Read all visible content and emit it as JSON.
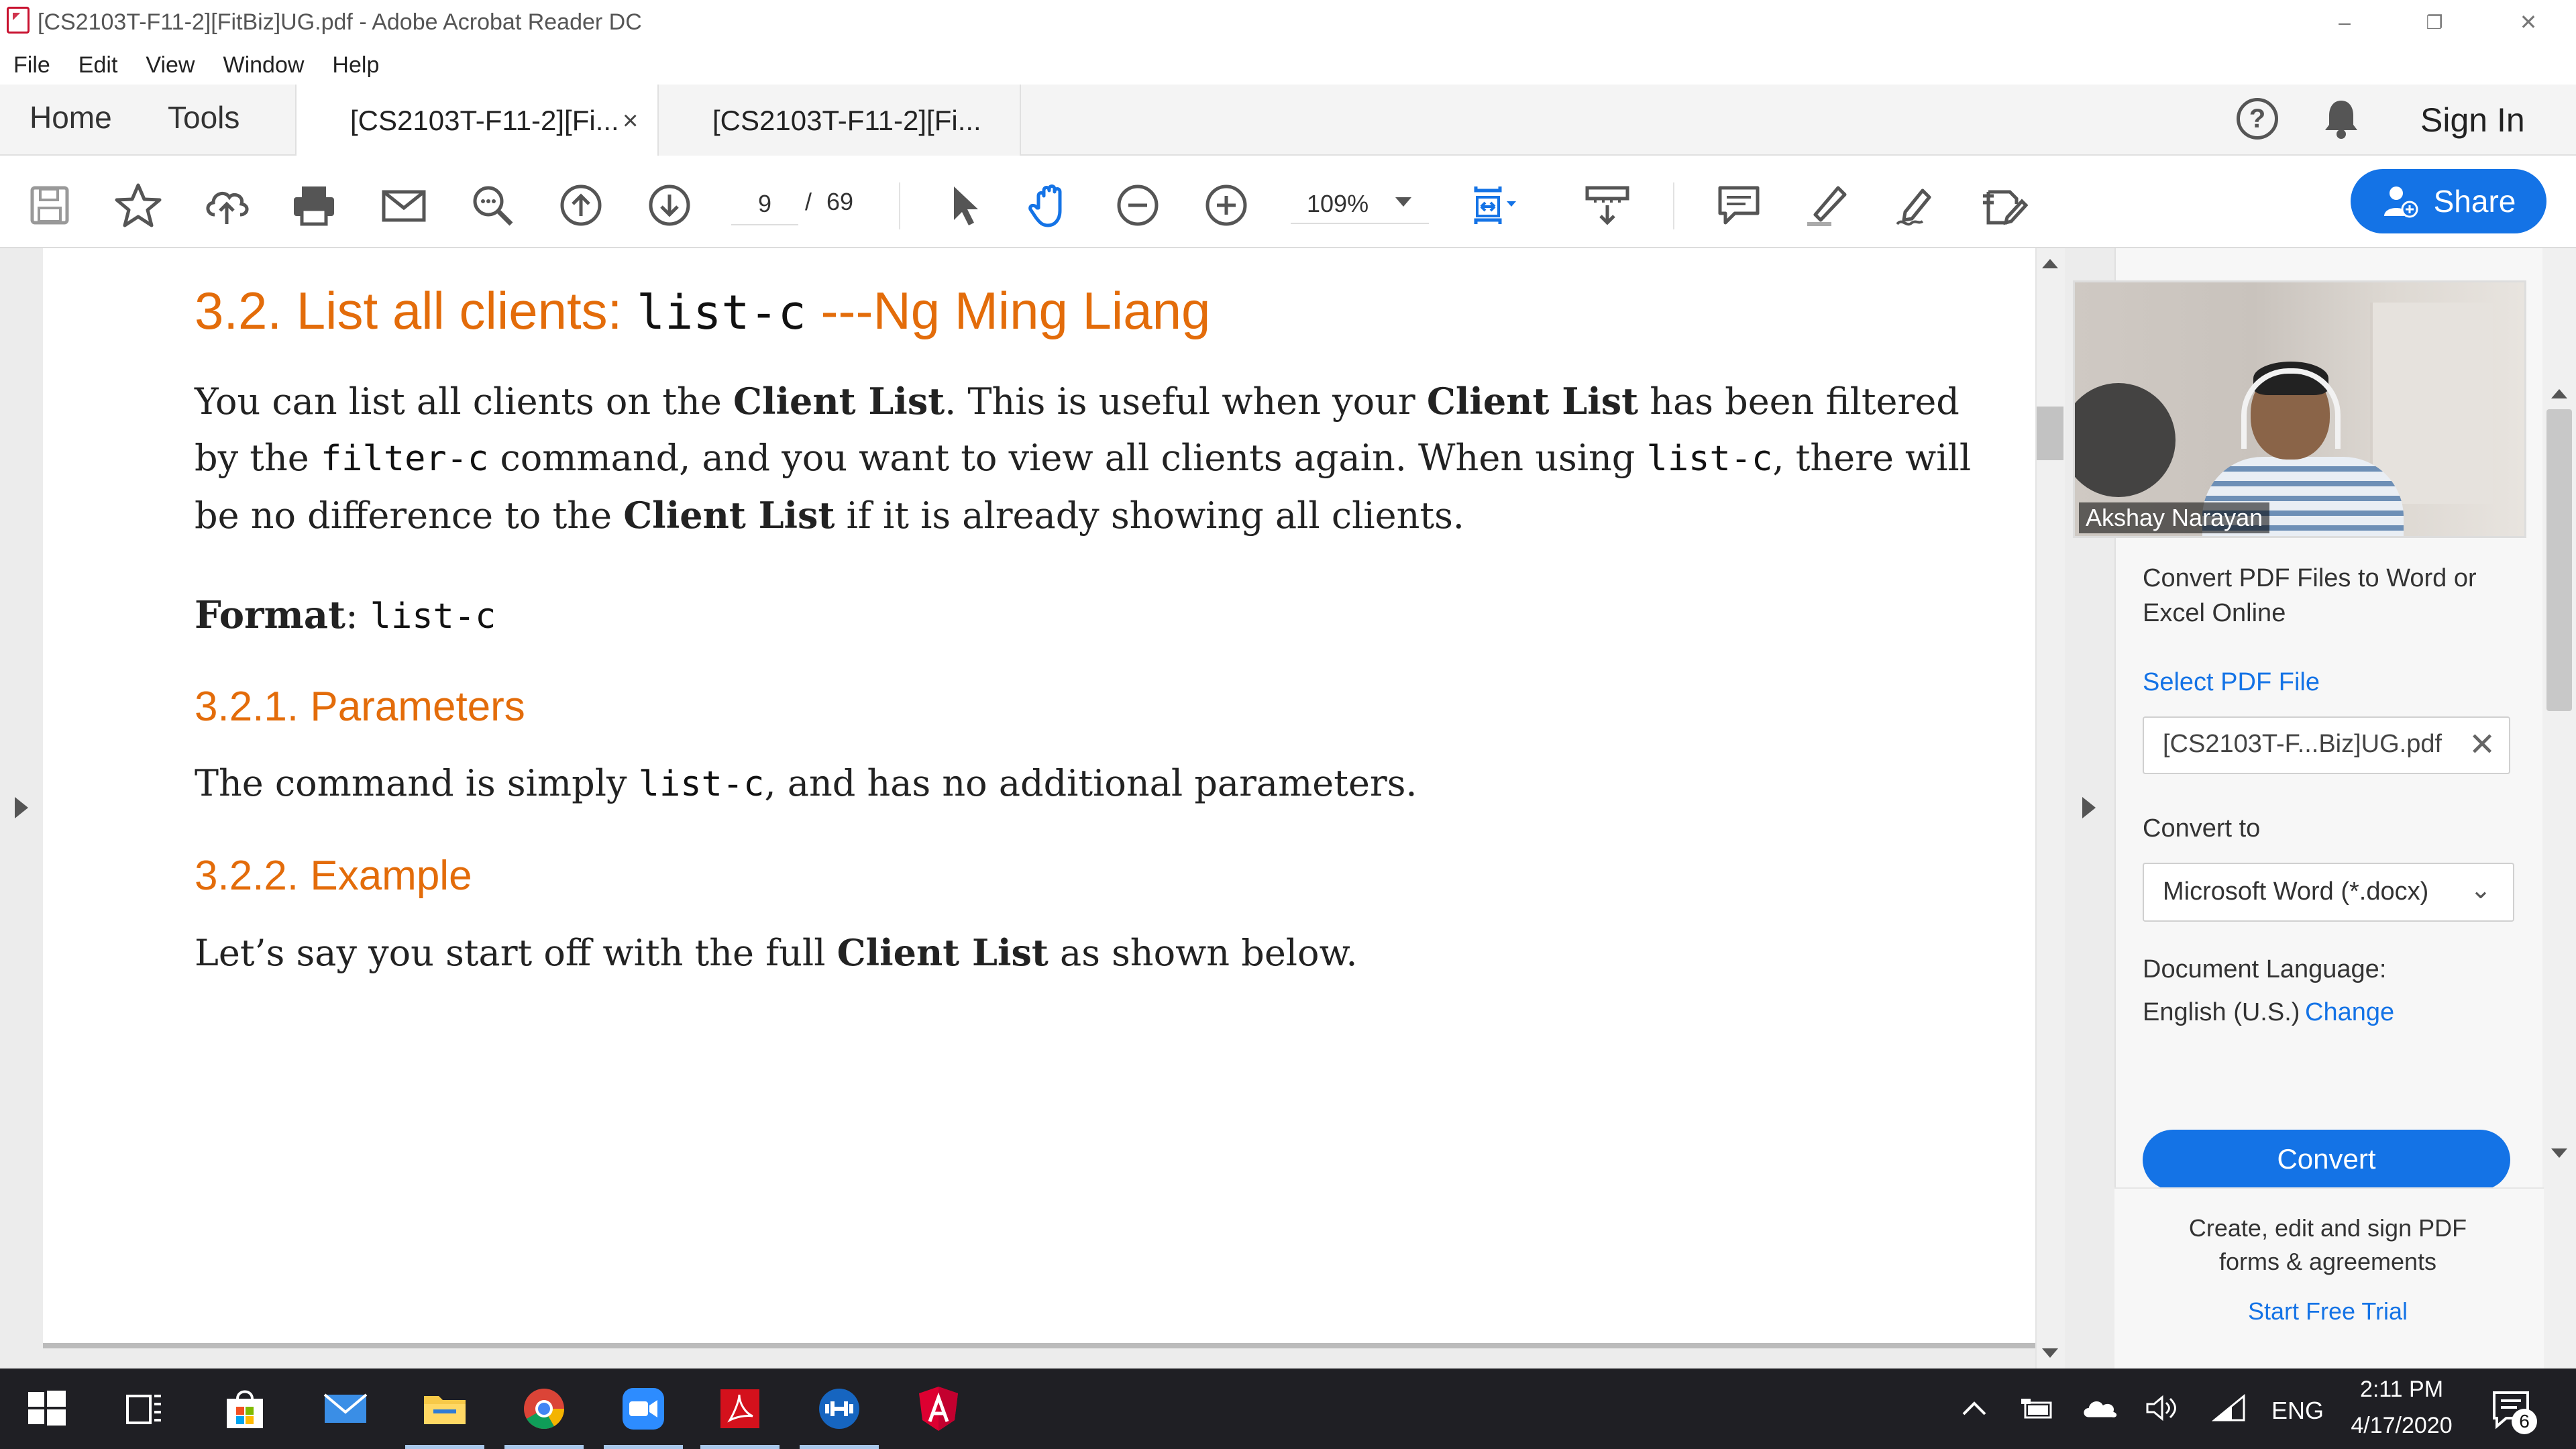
{
  "window": {
    "title": "[CS2103T-F11-2][FitBiz]UG.pdf - Adobe Acrobat Reader DC",
    "minimize": "–",
    "restore": "❐",
    "close": "✕"
  },
  "menu": [
    "File",
    "Edit",
    "View",
    "Window",
    "Help"
  ],
  "tabs": {
    "home": "Home",
    "tools": "Tools",
    "doc1": "[CS2103T-F11-2][Fi...",
    "doc1_close": "×",
    "doc2": "[CS2103T-F11-2][Fi..."
  },
  "header_right": {
    "help": "?",
    "sign_in": "Sign In"
  },
  "toolbar": {
    "page_current": "9",
    "page_separator": "/",
    "page_total": "69",
    "zoom": "109%",
    "share_label": "Share"
  },
  "document": {
    "heading_prefix": "3.2. List all clients: ",
    "heading_code": "list-c",
    "heading_suffix": " ---Ng Ming Liang",
    "para1": {
      "t1": "You can list all clients on the ",
      "b1": "Client List",
      "t2": ". This is useful when your ",
      "b2": "Client List",
      "t3": " has been filtered by the ",
      "c1": "filter-c",
      "t4": " command, and you want to view all clients again. When using ",
      "c2": "list-c",
      "t5": ", there will be no difference to the ",
      "b3": "Client List",
      "t6": " if it is already showing all clients."
    },
    "format_label": "Format",
    "format_colon": ": ",
    "format_code": "list-c",
    "sub1": "3.2.1. Parameters",
    "para2": {
      "t1": "The command is simply ",
      "c1": "list-c",
      "t2": ", and has no additional parameters."
    },
    "sub2": "3.2.2. Example",
    "para3": {
      "t1": "Let’s say you start off with the full ",
      "b1": "Client List",
      "t2": " as shown below."
    }
  },
  "video": {
    "participant_name": "Akshay Narayan"
  },
  "panel": {
    "promo": "Convert PDF Files to Word or Excel Online",
    "select_label": "Select PDF File",
    "file_name": "[CS2103T-F...Biz]UG.pdf",
    "clear": "✕",
    "convert_to_label": "Convert to",
    "format_value": "Microsoft Word (*.docx)",
    "format_caret": "⌄",
    "language_label": "Document Language:",
    "language_value": "English (U.S.)",
    "language_change": "Change",
    "convert_button": "Convert",
    "footer_text": "Create, edit and sign PDF forms & agreements",
    "footer_link": "Start Free Trial"
  },
  "taskbar": {
    "language": "ENG",
    "time": "2:11 PM",
    "date": "4/17/2020",
    "notification_count": "6"
  },
  "colors": {
    "heading_orange": "#e36c0a",
    "accent_blue": "#1473e6",
    "taskbar": "#1f1f24"
  }
}
